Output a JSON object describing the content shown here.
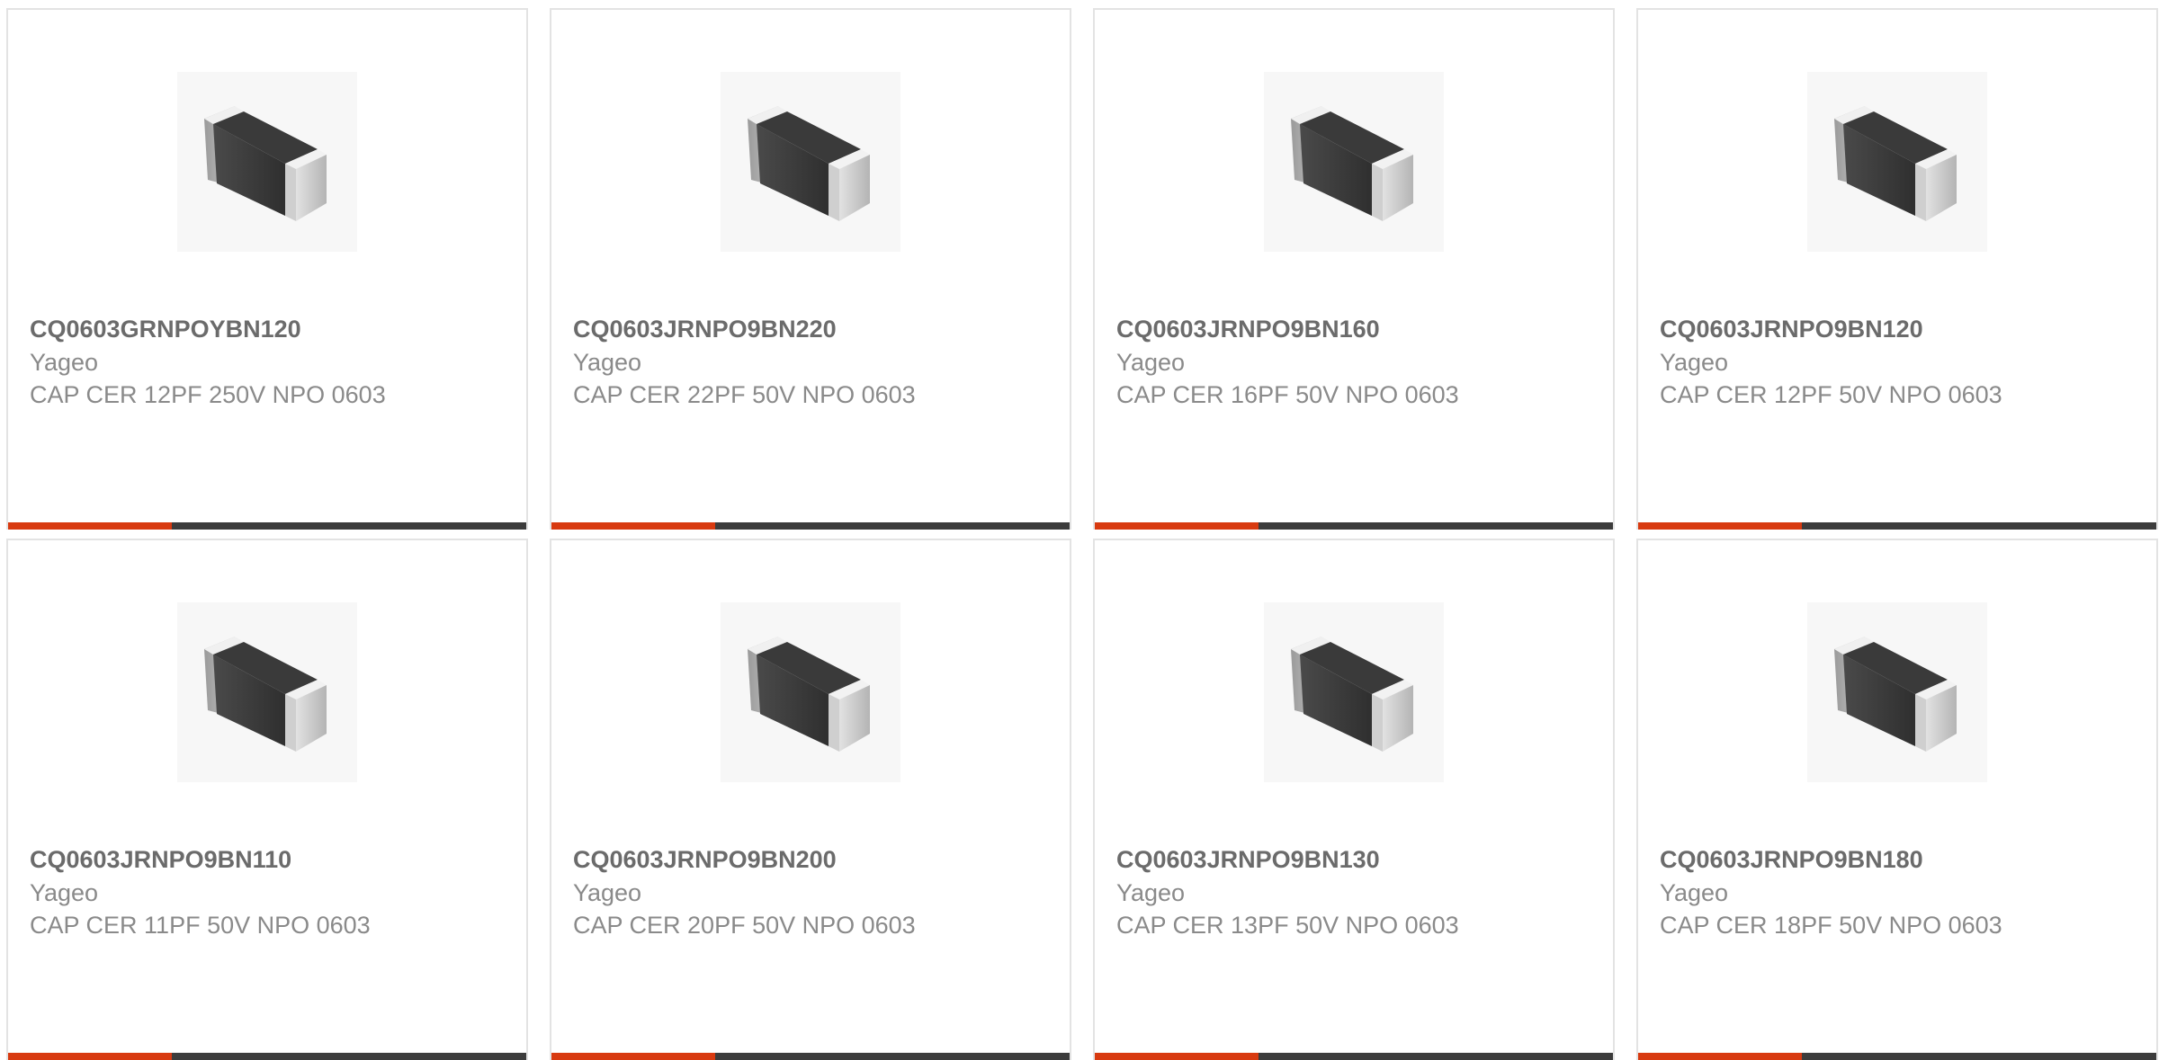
{
  "colors": {
    "accent": "#d83a10",
    "bar_dark": "#3c3c3c",
    "part_number": "#6b6b6b",
    "text_muted": "#8a8a8a",
    "card_border": "#e3e3e3"
  },
  "product_image_icon": "capacitor-chip-0603-icon",
  "products": [
    {
      "part_number": "CQ0603GRNPOYBN120",
      "manufacturer": "Yageo",
      "description": "CAP CER 12PF 250V NPO 0603"
    },
    {
      "part_number": "CQ0603JRNPO9BN220",
      "manufacturer": "Yageo",
      "description": "CAP CER 22PF 50V NPO 0603"
    },
    {
      "part_number": "CQ0603JRNPO9BN160",
      "manufacturer": "Yageo",
      "description": "CAP CER 16PF 50V NPO 0603"
    },
    {
      "part_number": "CQ0603JRNPO9BN120",
      "manufacturer": "Yageo",
      "description": "CAP CER 12PF 50V NPO 0603"
    },
    {
      "part_number": "CQ0603JRNPO9BN110",
      "manufacturer": "Yageo",
      "description": "CAP CER 11PF 50V NPO 0603"
    },
    {
      "part_number": "CQ0603JRNPO9BN200",
      "manufacturer": "Yageo",
      "description": "CAP CER 20PF 50V NPO 0603"
    },
    {
      "part_number": "CQ0603JRNPO9BN130",
      "manufacturer": "Yageo",
      "description": "CAP CER 13PF 50V NPO 0603"
    },
    {
      "part_number": "CQ0603JRNPO9BN180",
      "manufacturer": "Yageo",
      "description": "CAP CER 18PF 50V NPO 0603"
    }
  ]
}
